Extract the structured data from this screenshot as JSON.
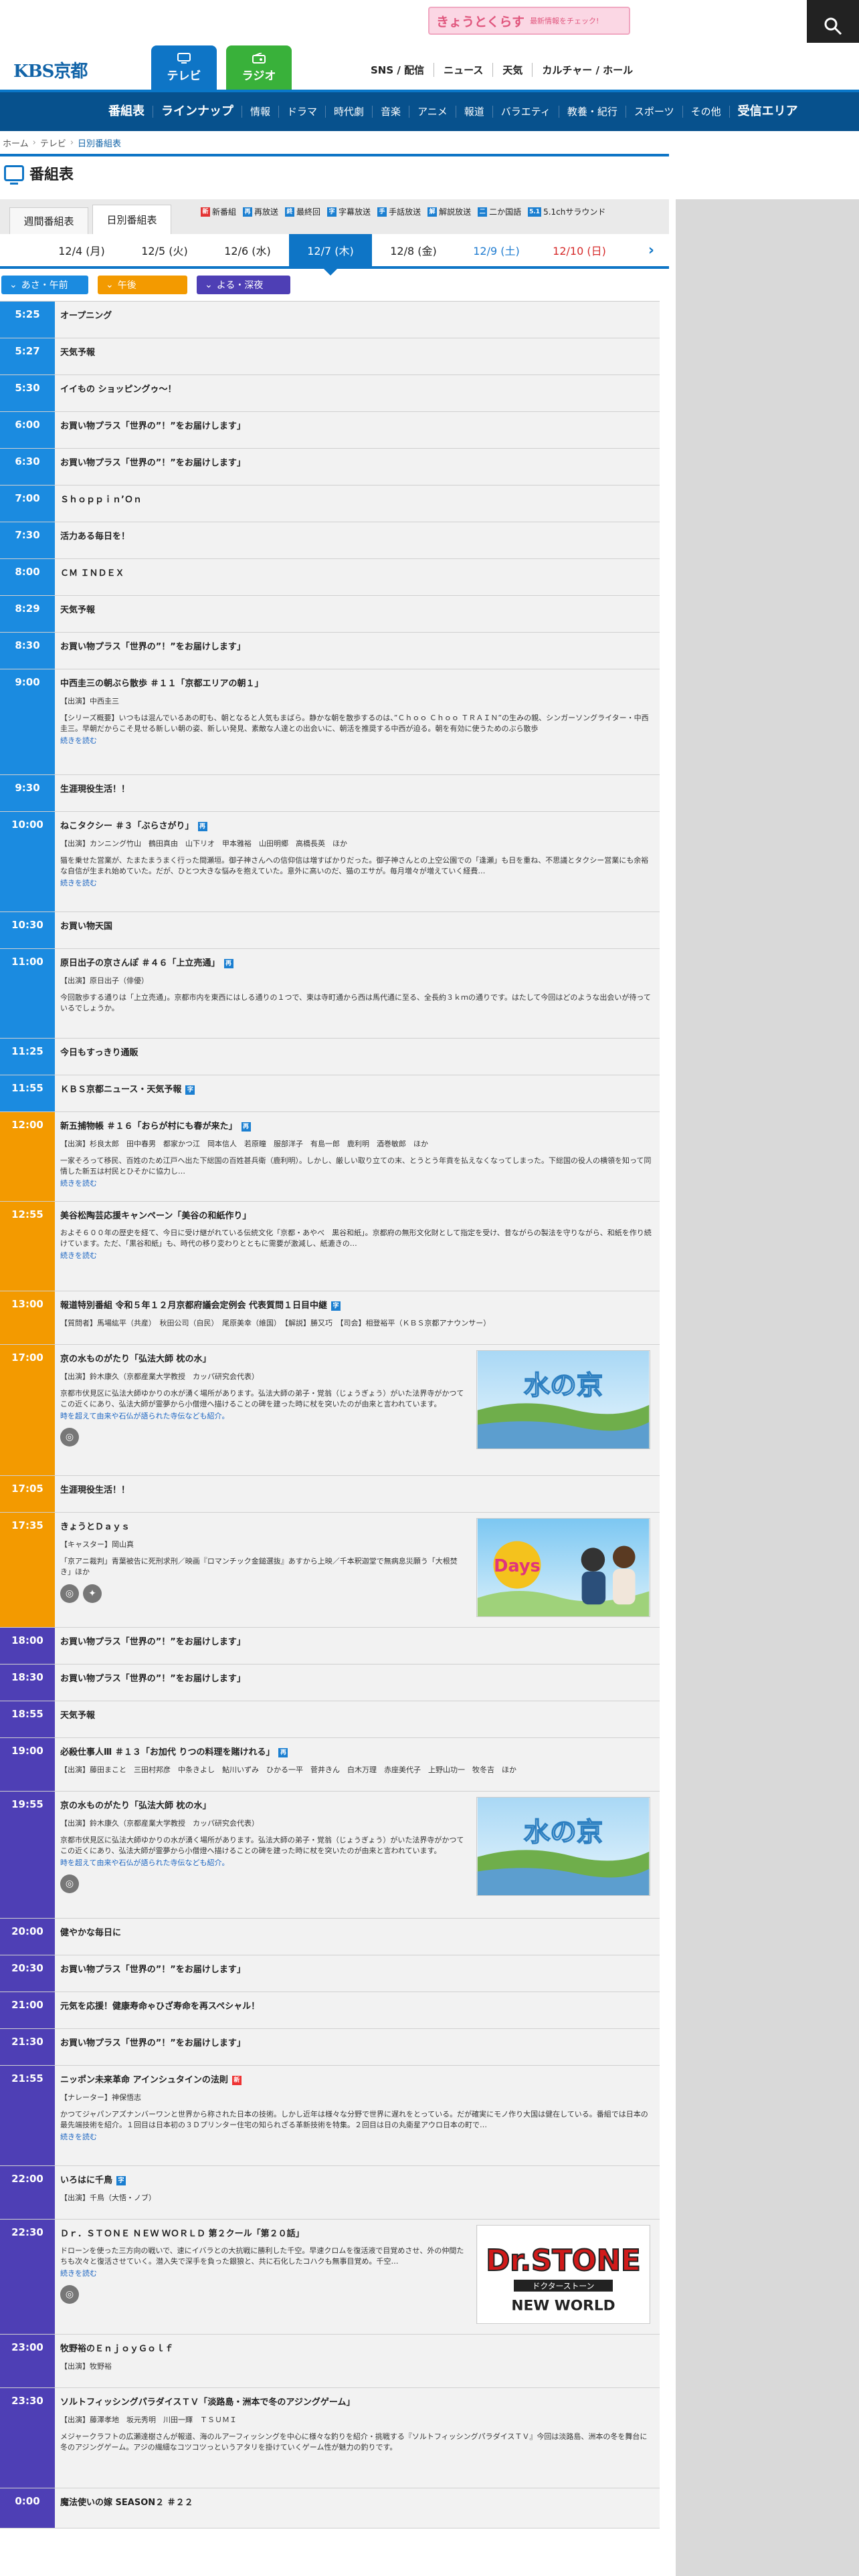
{
  "promo": {
    "logo": "きょうとくらす",
    "sub": "最新情報をチェック!"
  },
  "brand": {
    "logo": "KBS京都"
  },
  "media_tabs": [
    {
      "label": "テレビ"
    },
    {
      "label": "ラジオ"
    }
  ],
  "header_links": [
    "SNS / 配信",
    "ニュース",
    "天気",
    "カルチャー / ホール"
  ],
  "nav": {
    "items": [
      "番組表",
      "ラインナップ",
      "情報",
      "ドラマ",
      "時代劇",
      "音楽",
      "アニメ",
      "報道",
      "バラエティ",
      "教養・紀行",
      "スポーツ",
      "その他",
      "受信エリア"
    ]
  },
  "breadcrumb": [
    "ホーム",
    "テレビ",
    "日別番組表"
  ],
  "page_title": "番組表",
  "tabs": [
    "週間番組表",
    "日別番組表"
  ],
  "legend": [
    {
      "mark": "新",
      "label": "新番組",
      "color": "#e33333"
    },
    {
      "mark": "再",
      "label": "再放送",
      "color": "#1b7fd1"
    },
    {
      "mark": "終",
      "label": "最終回",
      "color": "#1b7fd1"
    },
    {
      "mark": "字",
      "label": "字幕放送",
      "color": "#1b7fd1"
    },
    {
      "mark": "手",
      "label": "手話放送",
      "color": "#1b7fd1"
    },
    {
      "mark": "解",
      "label": "解説放送",
      "color": "#1b7fd1"
    },
    {
      "mark": "二",
      "label": "二か国語",
      "color": "#1b7fd1"
    },
    {
      "mark": "5.1",
      "label": "5.1chサラウンド",
      "color": "#1b7fd1"
    }
  ],
  "dates": [
    "12/4 (月)",
    "12/5 (火)",
    "12/6 (水)",
    "12/7 (木)",
    "12/8 (金)",
    "12/9 (土)",
    "12/10 (日)"
  ],
  "periods": [
    "あさ・午前",
    "午後",
    "よる・深夜"
  ],
  "programs": [
    {
      "period": "m",
      "time": "5:25",
      "title": "オープニング",
      "h": 55
    },
    {
      "period": "m",
      "time": "5:27",
      "title": "天気予報",
      "h": 55
    },
    {
      "period": "m",
      "time": "5:30",
      "title": "イイもの ショッピングゥ〜！",
      "h": 55
    },
    {
      "period": "m",
      "time": "6:00",
      "title": "お買い物プラス「世界の”！”をお届けします」",
      "h": 55
    },
    {
      "period": "m",
      "time": "6:30",
      "title": "お買い物プラス「世界の”！”をお届けします」",
      "h": 55
    },
    {
      "period": "m",
      "time": "7:00",
      "title": "Ｓｈｏｐｐｉｎ’Ｏｎ",
      "h": 55
    },
    {
      "period": "m",
      "time": "7:30",
      "title": "活力ある毎日を！",
      "h": 55
    },
    {
      "period": "m",
      "time": "8:00",
      "title": "ＣＭ ＩＮＤＥＸ",
      "h": 55
    },
    {
      "period": "m",
      "time": "8:29",
      "title": "天気予報",
      "h": 55
    },
    {
      "period": "m",
      "time": "8:30",
      "title": "お買い物プラス「世界の”！”をお届けします」",
      "h": 55
    },
    {
      "period": "m",
      "time": "9:00",
      "title": "中西圭三の朝ぶら散歩 ＃１１「京都エリアの朝１」",
      "cast": "【出演】中西圭三",
      "desc": "【シリーズ概要】いつもは混んでいるあの町も、朝となると人気もまばら。静かな朝を散歩するのは、”Ｃｈｏｏ Ｃｈｏｏ ＴＲＡＩＮ”の生みの親、シンガーソングライター・中西圭三。早朝だからこそ見せる新しい朝の姿、新しい発見、素敵な人達との出会いに、朝活を推奨する中西が迫る。朝を有効に使うためのぶら散歩",
      "more": "続きを読む",
      "h": 158
    },
    {
      "period": "m",
      "time": "9:30",
      "title": "生涯現役生活！！",
      "h": 55
    },
    {
      "period": "m",
      "time": "10:00",
      "title": "ねこタクシー ＃３「ぶらさがり」",
      "tag": "再",
      "cast": "【出演】カンニング竹山　鶴田真由　山下リオ　甲本雅裕　山田明郷　高橋長英　ほか",
      "desc": "猫を乗せた営業が、たまたまうまく行った間瀬垣。御子神さんへの信仰信は増すばかりだった。御子神さんとの上空公園での「逢瀬」も日を重ね、不思議とタクシー営業にも余裕な自信が生まれ始めていた。だが、ひとつ大きな悩みを抱えていた。意外に高いのだ、猫のエサが。毎月増々が増えていく経費…",
      "more": "続きを読む",
      "h": 150
    },
    {
      "period": "m",
      "time": "10:30",
      "title": "お買い物天国",
      "h": 55
    },
    {
      "period": "m",
      "time": "11:00",
      "title": "原日出子の京さんぽ ＃４６「上立売通」",
      "tag": "再",
      "cast": "【出演】原日出子（俳優）",
      "desc": "今回散歩する通りは「上立売通」。京都市内を東西にはしる通りの１つで、東は寺町通から西は馬代通に至る、全長約３ｋｍの通りです。はたして今回はどのような出会いが待っているでしょうか。",
      "h": 134
    },
    {
      "period": "m",
      "time": "11:25",
      "title": "今日もすっきり通販",
      "h": 55
    },
    {
      "period": "m",
      "time": "11:55",
      "title": "ＫＢＳ京都ニュース・天気予報",
      "tag": "字",
      "h": 55
    },
    {
      "period": "a",
      "time": "12:00",
      "title": "新五捕物帳 ＃１６「おらが村にも春が来た」",
      "tag": "再",
      "cast": "【出演】杉良太郎　田中春男　都家かつ江　岡本信人　若原瞳　服部洋子　有島一郎　鹿利明　酒巻敏郎　ほか",
      "desc": "一家そろって移民、百姓のため江戸へ出た下総国の百姓甚兵衛（鹿利明）。しかし、厳しい取り立ての末、とうとう年貢を払えなくなってしまった。下総国の役人の横領を知って同情した新五は村民とひそかに協力し…",
      "more": "続きを読む",
      "h": 134
    },
    {
      "period": "a",
      "time": "12:55",
      "title": "美谷松陶芸応援キャンペーン「美谷の和紙作り」",
      "desc": "およそ６００年の歴史を経て、今日に受け継がれている伝統文化「京都・あやべ　黒谷和紙」。京都府の無形文化財として指定を受け、昔ながらの製法を守りながら、和紙を作り続けています。ただ、「黒谷和紙」も、時代の移り変わりとともに需要が激減し、紙漉きの…",
      "more": "続きを読む",
      "h": 134
    },
    {
      "period": "a",
      "time": "13:00",
      "title": "報道特別番組 令和５年１２月京都府議会定例会 代表質問１日目中継",
      "tag": "字",
      "cast": "【質問者】馬場紘平（共産）　秋田公司（自民）　尾原美幸（維国）　【解説】勝又巧　【司会】相登裕平（ＫＢＳ京都アナウンサー）",
      "h": 80
    },
    {
      "period": "a",
      "time": "17:00",
      "title": "京の水ものがたり「弘法大師 枕の水」",
      "cast": "【出演】鈴木康久（京都産業大学教授　カッパ研究会代表）",
      "desc": "京都市伏見区に弘法大師ゆかりの水が湧く場所があります。弘法大師の弟子・覚翁（じょうぎょう）がいた法界寺がかつてこの近くにあり、弘法大師が霊夢から小僧燈へ描けることの碑を建った時に杖を突いたのが由来と言われています。",
      "more": "時を超えて由来や石仏が語られた寺伝なども紹介。",
      "thumb": "water",
      "icons": [
        "globe"
      ],
      "h": 196
    },
    {
      "period": "a",
      "time": "17:05",
      "title": "生涯現役生活！！",
      "h": 55
    },
    {
      "period": "a",
      "time": "17:35",
      "title": "きょうとＤａｙｓ",
      "cast": "【キャスター】岡山真",
      "desc": "「京アニ裁判」青葉被告に死刑求刑／映画『ロマンチック金鎚選抜』あすから上映／千本釈迦堂で無病息災願う「大根焚き」ほか",
      "thumb": "days",
      "icons": [
        "globe",
        "twitter"
      ],
      "h": 172
    },
    {
      "period": "e",
      "time": "18:00",
      "title": "お買い物プラス「世界の”！”をお届けします」",
      "h": 55
    },
    {
      "period": "e",
      "time": "18:30",
      "title": "お買い物プラス「世界の”！”をお届けします」",
      "h": 55
    },
    {
      "period": "e",
      "time": "18:55",
      "title": "天気予報",
      "h": 55
    },
    {
      "period": "e",
      "time": "19:00",
      "title": "必殺仕事人Ⅲ ＃１３「お加代 りつの料理を賭けれる」",
      "tag": "再",
      "cast": "【出演】藤田まこと　三田村邦彦　中条きよし　鮎川いずみ　ひかる一平　菅井きん　白木万理　赤座美代子　上野山功一　牧冬吉　ほか",
      "h": 80
    },
    {
      "period": "e",
      "time": "19:55",
      "title": "京の水ものがたり「弘法大師 枕の水」",
      "cast": "【出演】鈴木康久（京都産業大学教授　カッパ研究会代表）",
      "desc": "京都市伏見区に弘法大師ゆかりの水が湧く場所があります。弘法大師の弟子・覚翁（じょうぎょう）がいた法界寺がかつてこの近くにあり、弘法大師が霊夢から小僧燈へ描けることの碑を建った時に杖を突いたのが由来と言われています。",
      "more": "時を超えて由来や石仏が語られた寺伝なども紹介。",
      "thumb": "water",
      "icons": [
        "globe"
      ],
      "h": 190
    },
    {
      "period": "e",
      "time": "20:00",
      "title": "健やかな毎日に",
      "h": 55
    },
    {
      "period": "e",
      "time": "20:30",
      "title": "お買い物プラス「世界の”！”をお届けします」",
      "h": 55
    },
    {
      "period": "e",
      "time": "21:00",
      "title": "元気を応援！健康寿命ゃひざ寿命を再スペシャル！",
      "h": 55
    },
    {
      "period": "e",
      "time": "21:30",
      "title": "お買い物プラス「世界の”！”をお届けします」",
      "h": 55
    },
    {
      "period": "e",
      "time": "21:55",
      "title": "ニッポン未来革命 アインシュタインの法則",
      "tag": "新",
      "cast": "【ナレーター】神保悟志",
      "desc": "かつてジャパンアズナンバーワンと世界から称された日本の技術。しかし近年は様々な分野で世界に遅れをとっている。だが確実にモノ作り大国は健在している。番組では日本の最先端技術を紹介。１回目は日本初の３Ｄプリンター住宅の知られざる革新技術を特集。２回目は日の丸衛星アウロ日本の町で…",
      "more": "続きを読む",
      "h": 150
    },
    {
      "period": "e",
      "time": "22:00",
      "title": "いろはに千鳥",
      "tag": "字",
      "cast": "【出演】千鳥（大悟・ノブ）",
      "h": 80
    },
    {
      "period": "e",
      "time": "22:30",
      "title": "Ｄｒ．ＳＴＯＮＥ ＮＥＷ ＷＯＲＬＤ 第２クール「第２０話」",
      "desc": "ドローンを使った三方向の戦いで、速にイバラとの大抗戦に勝利した千空。早速クロムを復活液で目覚めさせ、外の仲間たちも次々と復活させていく。潜入失で深手を負った銀狼と、共に石化したコハクも無事目覚め。千空…",
      "more": "続きを読む",
      "thumb": "drstone",
      "icons": [
        "globe"
      ],
      "h": 172
    },
    {
      "period": "e",
      "time": "23:00",
      "title": "牧野裕のＥｎｊｏｙＧｏｌｆ",
      "cast": "【出演】牧野裕",
      "h": 80
    },
    {
      "period": "e",
      "time": "23:30",
      "title": "ソルトフィッシングパラダイスＴＶ「淡路島・洲本で冬のアジングゲーム」",
      "cast": "【出演】藤澤孝地　坂元秀明　川田一輝　ＴＳＵＭＩ",
      "desc": "メジャークラフトの広瀬達樹さんが報道、海のルアーフィッシングを中心に様々な釣りを紹介・挑戦する『ソルトフィッシングパラダイスＴＶ』今回は淡路島、洲本の冬を舞台に冬のアジングゲーム。アジの繊細なコツコツっというアタリを掛けていくゲーム性が魅力の釣りです。",
      "h": 150
    },
    {
      "period": "e",
      "time": "0:00",
      "title": "魔法使いの嫁 SEASON２ ＃２２",
      "h": 60
    }
  ]
}
